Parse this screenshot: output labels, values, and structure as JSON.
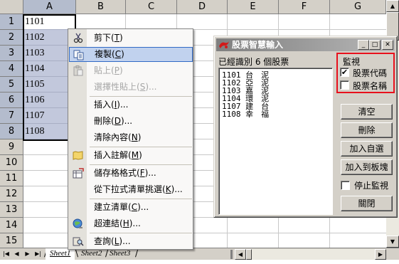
{
  "sheet": {
    "columns": [
      "A",
      "B",
      "C",
      "D",
      "E",
      "F",
      "G"
    ],
    "rows": [
      "1",
      "2",
      "3",
      "4",
      "5",
      "6",
      "7",
      "8",
      "9",
      "10",
      "11",
      "12",
      "13",
      "14",
      "15",
      "16"
    ],
    "column_a_cells": [
      "1101",
      "1102",
      "1103",
      "1104",
      "1105",
      "1106",
      "1107",
      "1108"
    ],
    "tabs": [
      "Sheet1",
      "Sheet2",
      "Sheet3"
    ],
    "active_tab": "Sheet1"
  },
  "context_menu": {
    "items": [
      {
        "label": "剪下",
        "key": "T",
        "icon": "scissors-icon",
        "enabled": true
      },
      {
        "label": "複製",
        "key": "C",
        "icon": "copy-icon",
        "enabled": true,
        "highlighted": true
      },
      {
        "label": "貼上",
        "key": "P",
        "icon": "paste-icon",
        "enabled": false
      },
      {
        "label": "選擇性貼上",
        "key": "S",
        "suffix": "...",
        "enabled": false
      },
      {
        "label": "插入",
        "key": "I",
        "suffix": "...",
        "enabled": true
      },
      {
        "label": "刪除",
        "key": "D",
        "suffix": "...",
        "enabled": true
      },
      {
        "label": "清除內容",
        "key": "N",
        "enabled": true
      },
      {
        "label": "插入註解",
        "key": "M",
        "icon": "comment-icon",
        "enabled": true
      },
      {
        "label": "儲存格格式",
        "key": "F",
        "suffix": "...",
        "icon": "format-cells-icon",
        "enabled": true
      },
      {
        "label": "從下拉式清單挑選",
        "key": "K",
        "suffix": "...",
        "enabled": true
      },
      {
        "label": "建立清單",
        "key": "C",
        "suffix": "...",
        "enabled": true
      },
      {
        "label": "超連結",
        "key": "H",
        "suffix": "...",
        "icon": "hyperlink-icon",
        "enabled": true
      },
      {
        "label": "查詢",
        "key": "L",
        "suffix": "...",
        "icon": "research-icon",
        "enabled": true
      }
    ]
  },
  "dialog": {
    "title": "股票智慧輸入",
    "count_text": "已經識別 6 個股票",
    "stocks": [
      "1101 台　泥",
      "1102 亞　泥",
      "1103 嘉　泥",
      "1104 環　泥",
      "1107 建　台",
      "1108 幸　福"
    ],
    "monitor": {
      "title": "監視",
      "options": [
        {
          "label": "股票代碼",
          "checked": true
        },
        {
          "label": "股票名稱",
          "checked": false
        }
      ]
    },
    "buttons": {
      "clear": "清空",
      "delete": "刪除",
      "add_watch": "加入自選",
      "add_board": "加入到板塊",
      "close": "關閉"
    },
    "stop_monitor": {
      "label": "停止監視",
      "checked": false
    },
    "accent_color": "#e8101c"
  }
}
